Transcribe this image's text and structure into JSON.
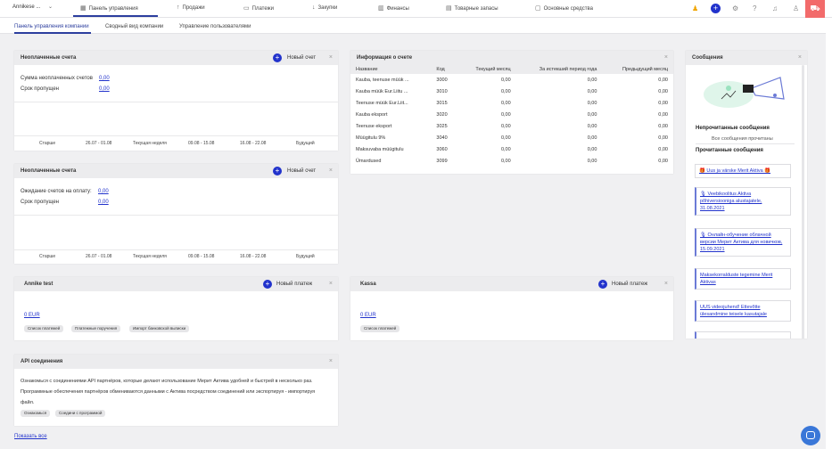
{
  "topbar": {
    "company": "Annikese ...",
    "nav": [
      {
        "label": "Панель управления",
        "icon": "grid-icon",
        "glyph": "▦"
      },
      {
        "label": "Продажи",
        "icon": "arrow-up-icon",
        "glyph": "↑"
      },
      {
        "label": "Платежи",
        "icon": "card-icon",
        "glyph": "▭"
      },
      {
        "label": "Закупки",
        "icon": "arrow-down-icon",
        "glyph": "↓"
      },
      {
        "label": "Финансы",
        "icon": "chart-icon",
        "glyph": "▥"
      },
      {
        "label": "Товарные запасы",
        "icon": "inventory-icon",
        "glyph": "▤"
      },
      {
        "label": "Основные средства",
        "icon": "assets-icon",
        "glyph": "▢"
      }
    ]
  },
  "subtabs": [
    "Панель управления компании",
    "Сводный вид компании",
    "Управление пользователями"
  ],
  "unpaid_sales": {
    "title": "Неоплаченные счета",
    "action": "Новый счет",
    "sum_label": "Сумма неоплаченных счетов",
    "sum_value": "0,00",
    "overdue_label": "Срок пропущен",
    "overdue_value": "0,00",
    "buckets": [
      "Старше",
      "26.07 - 01.08",
      "Текущая неделя",
      "09.08 - 15.08",
      "16.08 - 22.08",
      "Будущий"
    ]
  },
  "unpaid_purchases": {
    "title": "Неоплаченные счета",
    "action": "Новый счет",
    "waiting_label": "Ожидание счетов на оплату:",
    "waiting_value": "0,00",
    "overdue_label": "Срок пропущен",
    "overdue_value": "0,00",
    "buckets": [
      "Старше",
      "26.07 - 01.08",
      "Текущая неделя",
      "09.08 - 15.08",
      "16.08 - 22.08",
      "Будущий"
    ]
  },
  "invoice_info": {
    "title": "Информация о счете",
    "columns": [
      "Название",
      "Код",
      "Текущий месяц",
      "За истекший период года",
      "Предыдущий месяц"
    ],
    "rows": [
      [
        "Kauba, teenuse müük ...",
        "3000",
        "0,00",
        "0,00",
        "0,00"
      ],
      [
        "Kauba müük Eur.Liitu ...",
        "3010",
        "0,00",
        "0,00",
        "0,00"
      ],
      [
        "Teenuse müük Eur.Liit...",
        "3015",
        "0,00",
        "0,00",
        "0,00"
      ],
      [
        "Kauba eksport",
        "3020",
        "0,00",
        "0,00",
        "0,00"
      ],
      [
        "Teenuse eksport",
        "3025",
        "0,00",
        "0,00",
        "0,00"
      ],
      [
        "Müügitulu 9%",
        "3040",
        "0,00",
        "0,00",
        "0,00"
      ],
      [
        "Maksuvaba müügitulu",
        "3060",
        "0,00",
        "0,00",
        "0,00"
      ],
      [
        "Ümardused",
        "3099",
        "0,00",
        "0,00",
        "0,00"
      ]
    ]
  },
  "bank": {
    "title": "Annike test",
    "action": "Новый платеж",
    "amount": "0 EUR",
    "chips": [
      "Список платежей",
      "Платежные поручения",
      "Импорт банковской выписки"
    ]
  },
  "cash": {
    "title": "Kassa",
    "action": "Новый платеж",
    "amount": "0 EUR",
    "chips": [
      "Список платежей"
    ]
  },
  "api": {
    "title": "API соединения",
    "text": "Ознакомься с соединениями API партнёров, которые делают использование Мерит Актива удобней и быстрей в несколько раз. Программные обеспечения партнёров обмениваются данными с Актива посредством соединений или экспортируя - импортируя файл.",
    "chips": [
      "Ознакомься",
      "Соедини с программой"
    ]
  },
  "messages": {
    "title": "Сообщения",
    "unread_heading": "Непрочитанные сообщения",
    "all_read": "Все сообщения прочитаны",
    "read_heading": "Прочитанные сообщения",
    "items": [
      "🎁 Uus ja värske Merit Aktiva 🎁",
      "🎙 Veebikoolitus Aktiva põhiversiooniga alustajatele, 31.08.2021",
      "🎙 Онлайн-обучение облачной версии Мерит Актива для новичков, 15.09.2021",
      "Maksekorralduste tegemine Merit Aktivas",
      "UUS videojuhend! Ettevõtte ülesandmine teisele kasutajale"
    ]
  },
  "footer": {
    "show_all": "Показать все"
  }
}
